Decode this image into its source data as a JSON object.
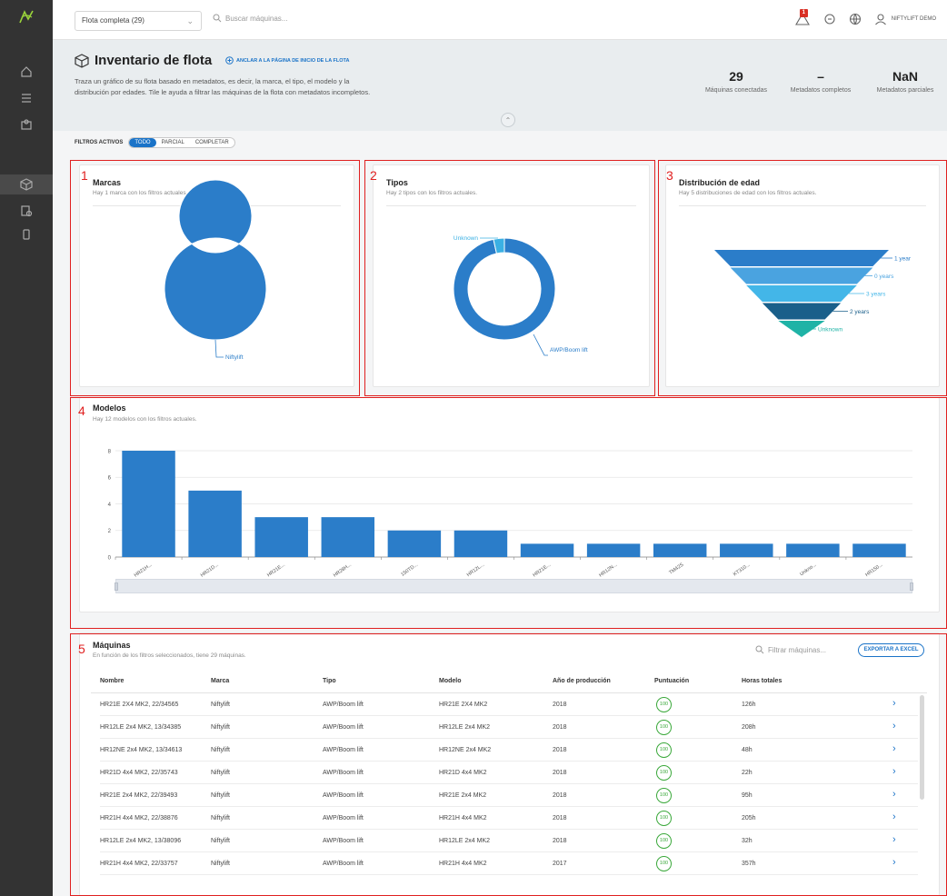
{
  "topbar": {
    "fleet_select": "Flota completa (29)",
    "search_placeholder": "Buscar máquinas...",
    "alert_count": "1",
    "user_name": "NIFTYLIFT DEMO"
  },
  "header": {
    "title": "Inventario de flota",
    "pin_label": "ANCLAR A LA PÁGINA DE INICIO DE LA FLOTA",
    "description": "Traza un gráfico de su flota basado en metadatos, es decir, la marca, el tipo, el modelo y la distribución por edades. Tile le ayuda a filtrar las máquinas de la flota con metadatos incompletos.",
    "stats": [
      {
        "value": "29",
        "label": "Máquinas conectadas"
      },
      {
        "value": "–",
        "label": "Metadatos completos"
      },
      {
        "value": "NaN",
        "label": "Metadatos parciales"
      }
    ]
  },
  "filters": {
    "label": "FILTROS ACTIVOS",
    "options": [
      "TODO",
      "PARCIAL",
      "COMPLETAR"
    ],
    "selected": "TODO"
  },
  "annotations": [
    "1",
    "2",
    "3",
    "4",
    "5"
  ],
  "cards": {
    "brands": {
      "title": "Marcas",
      "subtitle": "Hay 1 marca con los filtros actuales."
    },
    "types": {
      "title": "Tipos",
      "subtitle": "Hay 2 tipos con los filtros actuales."
    },
    "age": {
      "title": "Distribución de edad",
      "subtitle": "Hay 5 distribuciones de edad con los filtros actuales."
    },
    "models": {
      "title": "Modelos",
      "subtitle": "Hay 12 modelos con los filtros actuales."
    }
  },
  "chart_data": [
    {
      "type": "pie",
      "variant": "donut",
      "categories": [
        "Niftylift"
      ],
      "values": [
        29
      ],
      "colors": [
        "#2b7dc9"
      ]
    },
    {
      "type": "pie",
      "variant": "donut",
      "categories": [
        "AWP/Boom lift",
        "Unknown"
      ],
      "values": [
        28,
        1
      ],
      "colors": [
        "#2b7dc9",
        "#3bb0e3"
      ]
    },
    {
      "type": "funnel",
      "categories": [
        "1 year",
        "0 years",
        "3 years",
        "2 years",
        "Unknown"
      ],
      "colors": [
        "#2b7dc9",
        "#4aa3e0",
        "#43b6e8",
        "#1a5f8a",
        "#1fb3a6"
      ]
    },
    {
      "type": "bar",
      "categories": [
        "HR21H...",
        "HR21D...",
        "HR21E...",
        "HR28H...",
        "150TD...",
        "HR12L...",
        "HR21E...",
        "HR12N...",
        "TM42S",
        "KT310...",
        "Unkno...",
        "HR150..."
      ],
      "values": [
        8,
        5,
        3,
        3,
        2,
        2,
        1,
        1,
        1,
        1,
        1,
        1
      ],
      "yticks": [
        "0",
        "2",
        "4",
        "6",
        "8"
      ],
      "ylim": [
        0,
        8
      ],
      "grid": true,
      "color": "#2b7dc9"
    }
  ],
  "machines": {
    "title": "Máquinas",
    "subtitle": "En función de los filtros seleccionados, tiene 29 máquinas.",
    "filter_placeholder": "Filtrar máquinas...",
    "export_label": "EXPORTAR A EXCEL",
    "columns": [
      "Nombre",
      "Marca",
      "Tipo",
      "Modelo",
      "Año de producción",
      "Puntuación",
      "Horas totales"
    ],
    "rows": [
      [
        "HR21E 2X4 MK2, 22/34565",
        "Niftylift",
        "AWP/Boom lift",
        "HR21E 2X4 MK2",
        "2018",
        "100",
        "126h"
      ],
      [
        "HR12LE 2x4 MK2, 13/34385",
        "Niftylift",
        "AWP/Boom lift",
        "HR12LE 2x4 MK2",
        "2018",
        "100",
        "208h"
      ],
      [
        "HR12NE 2x4 MK2, 13/34613",
        "Niftylift",
        "AWP/Boom lift",
        "HR12NE 2x4 MK2",
        "2018",
        "100",
        "48h"
      ],
      [
        "HR21D 4x4 MK2, 22/35743",
        "Niftylift",
        "AWP/Boom lift",
        "HR21D 4x4 MK2",
        "2018",
        "100",
        "22h"
      ],
      [
        "HR21E 2x4 MK2, 22/39493",
        "Niftylift",
        "AWP/Boom lift",
        "HR21E 2x4 MK2",
        "2018",
        "100",
        "95h"
      ],
      [
        "HR21H 4x4 MK2, 22/38876",
        "Niftylift",
        "AWP/Boom lift",
        "HR21H 4x4 MK2",
        "2018",
        "100",
        "205h"
      ],
      [
        "HR12LE 2x4 MK2, 13/38096",
        "Niftylift",
        "AWP/Boom lift",
        "HR12LE 2x4 MK2",
        "2018",
        "100",
        "32h"
      ],
      [
        "HR21H 4x4 MK2, 22/33757",
        "Niftylift",
        "AWP/Boom lift",
        "HR21H 4x4 MK2",
        "2017",
        "100",
        "357h"
      ]
    ]
  }
}
